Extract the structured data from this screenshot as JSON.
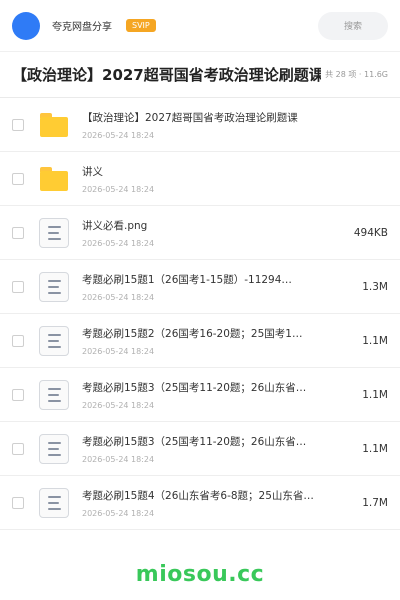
{
  "header": {
    "user_name": "夸克网盘分享",
    "badge": "SVIP",
    "search_placeholder": "搜索"
  },
  "folder": {
    "title": "【政治理论】2027超哥国省考政治理论刷题课",
    "meta": "共 28 项 · 11.6G"
  },
  "files": [
    {
      "name": "【政治理论】2027超哥国省考政治理论刷题课",
      "date": "2026-05-24 18:24",
      "size": "",
      "type": "folder"
    },
    {
      "name": "讲义",
      "date": "2026-05-24 18:24",
      "size": "",
      "type": "folder"
    },
    {
      "name": "讲义必看.png",
      "date": "2026-05-24 18:24",
      "size": "494KB",
      "type": "file"
    },
    {
      "name": "考题必刷15题1（26国考1-15题）-11294…",
      "date": "2026-05-24 18:24",
      "size": "1.3M",
      "type": "file"
    },
    {
      "name": "考题必刷15题2（26国考16-20题；25国考1…",
      "date": "2026-05-24 18:24",
      "size": "1.1M",
      "type": "file"
    },
    {
      "name": "考题必刷15题3（25国考11-20题；26山东省…",
      "date": "2026-05-24 18:24",
      "size": "1.1M",
      "type": "file"
    },
    {
      "name": "考题必刷15题3（25国考11-20题；26山东省…",
      "date": "2026-05-24 18:24",
      "size": "1.1M",
      "type": "file"
    },
    {
      "name": "考题必刷15题4（26山东省考6-8题；25山东省…",
      "date": "2026-05-24 18:24",
      "size": "1.7M",
      "type": "file"
    }
  ],
  "footer": {
    "brand": "miosou.cc"
  },
  "colors": {
    "accent": "#2f7bf6",
    "badge": "#f5a623",
    "folder": "#ffcc33",
    "brand": "#39c85a"
  }
}
